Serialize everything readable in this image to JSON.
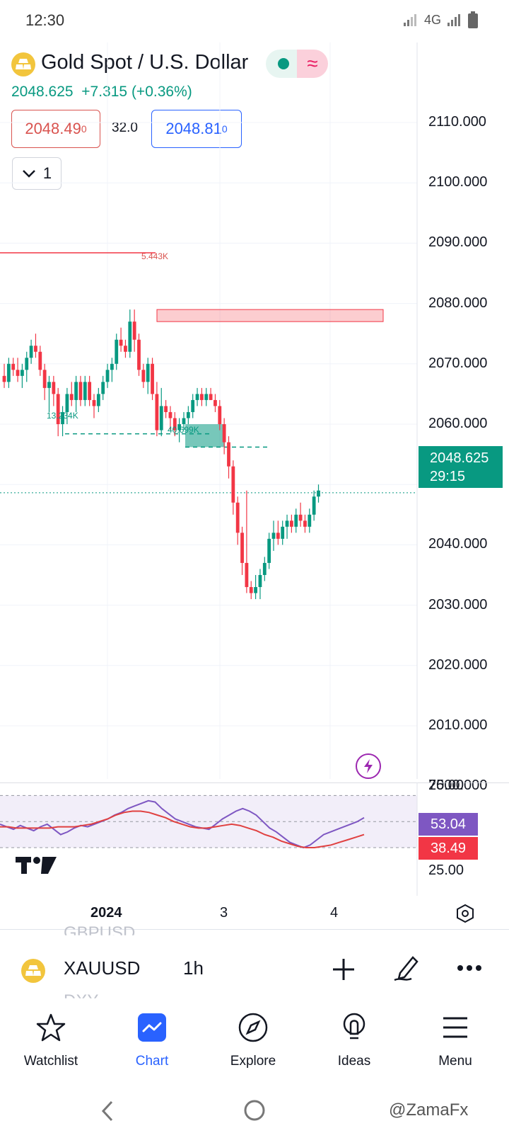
{
  "status_bar": {
    "time": "12:30",
    "network": "4G"
  },
  "symbol": {
    "name": "Gold Spot / U.S. Dollar",
    "last": "2048.625",
    "change": "+7.315",
    "change_pct": "(+0.36%)",
    "bid": "2048.49",
    "bid_sup": "0",
    "spread": "32.0",
    "ask": "2048.81",
    "ask_sup": "0",
    "indicator_count": "1"
  },
  "price_axis": [
    "2110.000",
    "2100.000",
    "2090.000",
    "2080.000",
    "2070.000",
    "2060.000",
    "2050.000",
    "2040.000",
    "2030.000",
    "2020.000",
    "2010.000",
    "2000.000"
  ],
  "current_price_tag": {
    "price": "2048.625",
    "countdown": "29:15"
  },
  "chart_annotations": {
    "high_volume": "5.443K",
    "low_left_volume": "13.234K",
    "low_mid_volume": "40.699K"
  },
  "rsi": {
    "axis_top": "75.00",
    "axis_bottom": "25.00",
    "rsi_value": "53.04",
    "ma_value": "38.49"
  },
  "time_axis": [
    "2024",
    "3",
    "4"
  ],
  "toolbar": {
    "ticker": "XAUUSD",
    "timeframe": "1h",
    "ghost_above": "GBPUSD",
    "ghost_below": "DXY"
  },
  "nav": [
    {
      "label": "Watchlist",
      "icon": "star-icon"
    },
    {
      "label": "Chart",
      "icon": "chart-icon"
    },
    {
      "label": "Explore",
      "icon": "compass-icon"
    },
    {
      "label": "Ideas",
      "icon": "lightbulb-icon"
    },
    {
      "label": "Menu",
      "icon": "menu-icon"
    }
  ],
  "watermark": "@ZamaFx",
  "colors": {
    "up": "#089981",
    "down": "#f23645",
    "accent": "#2962ff",
    "rsi": "#7e57c2",
    "rsi_ma": "#e04040"
  },
  "chart_data": {
    "type": "candlestick",
    "title": "",
    "xlabel": "",
    "ylabel": "",
    "ylim": [
      1996,
      2116
    ],
    "x": [
      0,
      1,
      2,
      3,
      4,
      5,
      6,
      7,
      8,
      9,
      10,
      11,
      12,
      13,
      14,
      15,
      16,
      17,
      18,
      19,
      20,
      21,
      22,
      23,
      24,
      25,
      26,
      27,
      28,
      29,
      30,
      31,
      32,
      33,
      34,
      35,
      36,
      37,
      38,
      39,
      40,
      41,
      42,
      43,
      44,
      45,
      46,
      47,
      48,
      49,
      50,
      51,
      52,
      53,
      54,
      55,
      56,
      57,
      58,
      59,
      60,
      61,
      62,
      63,
      64,
      65,
      66,
      67,
      68,
      69,
      70,
      71,
      72,
      73,
      74,
      75,
      76,
      77,
      78,
      79,
      80
    ],
    "ohlc": [
      [
        2068,
        2070,
        2066,
        2067
      ],
      [
        2067,
        2071,
        2066,
        2070
      ],
      [
        2070,
        2071,
        2068,
        2069
      ],
      [
        2069,
        2071,
        2067,
        2068
      ],
      [
        2068,
        2070,
        2066,
        2069
      ],
      [
        2069,
        2072,
        2067,
        2071
      ],
      [
        2071,
        2074,
        2070,
        2073
      ],
      [
        2073,
        2075,
        2071,
        2072
      ],
      [
        2072,
        2073,
        2068,
        2069
      ],
      [
        2069,
        2070,
        2064,
        2066
      ],
      [
        2066,
        2068,
        2062,
        2067
      ],
      [
        2067,
        2068,
        2063,
        2065
      ],
      [
        2065,
        2066,
        2058,
        2060
      ],
      [
        2060,
        2063,
        2058,
        2062
      ],
      [
        2062,
        2066,
        2060,
        2065
      ],
      [
        2065,
        2067,
        2063,
        2064
      ],
      [
        2064,
        2068,
        2062,
        2067
      ],
      [
        2067,
        2068,
        2063,
        2064
      ],
      [
        2064,
        2068,
        2063,
        2067
      ],
      [
        2067,
        2068,
        2063,
        2064
      ],
      [
        2064,
        2065,
        2061,
        2063
      ],
      [
        2063,
        2066,
        2062,
        2065
      ],
      [
        2065,
        2068,
        2064,
        2067
      ],
      [
        2067,
        2070,
        2066,
        2069
      ],
      [
        2069,
        2071,
        2067,
        2070
      ],
      [
        2070,
        2075,
        2069,
        2074
      ],
      [
        2074,
        2076,
        2072,
        2073
      ],
      [
        2073,
        2074,
        2071,
        2072
      ],
      [
        2072,
        2079,
        2071,
        2077
      ],
      [
        2077,
        2079,
        2072,
        2074
      ],
      [
        2074,
        2075,
        2068,
        2069
      ],
      [
        2069,
        2070,
        2066,
        2067
      ],
      [
        2067,
        2071,
        2065,
        2070
      ],
      [
        2070,
        2071,
        2064,
        2065
      ],
      [
        2065,
        2067,
        2058,
        2059
      ],
      [
        2059,
        2066,
        2058,
        2063
      ],
      [
        2063,
        2064,
        2061,
        2062
      ],
      [
        2062,
        2063,
        2059,
        2061
      ],
      [
        2061,
        2062,
        2058,
        2059
      ],
      [
        2059,
        2061,
        2057,
        2060
      ],
      [
        2060,
        2062,
        2059,
        2061
      ],
      [
        2061,
        2063,
        2060,
        2062
      ],
      [
        2062,
        2065,
        2061,
        2064
      ],
      [
        2064,
        2066,
        2063,
        2065
      ],
      [
        2065,
        2066,
        2063,
        2064
      ],
      [
        2064,
        2066,
        2063,
        2065
      ],
      [
        2065,
        2066,
        2064,
        2064
      ],
      [
        2064,
        2065,
        2062,
        2063
      ],
      [
        2063,
        2064,
        2059,
        2060
      ],
      [
        2060,
        2061,
        2055,
        2057
      ],
      [
        2057,
        2058,
        2051,
        2053
      ],
      [
        2053,
        2054,
        2045,
        2047
      ],
      [
        2047,
        2048,
        2040,
        2042
      ],
      [
        2042,
        2043,
        2035,
        2037
      ],
      [
        2037,
        2049,
        2032,
        2033
      ],
      [
        2033,
        2034,
        2031,
        2032
      ],
      [
        2032,
        2035,
        2031,
        2033
      ],
      [
        2033,
        2036,
        2031,
        2035
      ],
      [
        2035,
        2038,
        2034,
        2037
      ],
      [
        2037,
        2042,
        2036,
        2041
      ],
      [
        2041,
        2044,
        2039,
        2042
      ],
      [
        2042,
        2044,
        2040,
        2041
      ],
      [
        2041,
        2044,
        2040,
        2043
      ],
      [
        2043,
        2045,
        2041,
        2044
      ],
      [
        2044,
        2045,
        2042,
        2043
      ],
      [
        2043,
        2046,
        2042,
        2045
      ],
      [
        2045,
        2047,
        2043,
        2044
      ],
      [
        2044,
        2045,
        2042,
        2043
      ],
      [
        2043,
        2046,
        2042,
        2045
      ],
      [
        2045,
        2049,
        2044,
        2048
      ],
      [
        2048,
        2050,
        2047,
        2049
      ]
    ],
    "rsi": [
      48,
      46,
      44,
      47,
      45,
      43,
      46,
      48,
      44,
      40,
      42,
      45,
      47,
      46,
      48,
      50,
      52,
      55,
      57,
      60,
      62,
      64,
      66,
      65,
      60,
      56,
      52,
      50,
      48,
      46,
      45,
      44,
      48,
      52,
      55,
      58,
      60,
      58,
      55,
      50,
      45,
      42,
      38,
      34,
      32,
      30,
      32,
      36,
      40,
      42,
      44,
      46,
      48,
      50,
      53
    ],
    "rsi_ma": [
      46,
      46,
      45,
      45,
      45,
      45,
      45,
      46,
      46,
      46,
      47,
      48,
      50,
      52,
      55,
      57,
      58,
      58,
      57,
      55,
      53,
      50,
      48,
      46,
      45,
      45,
      46,
      47,
      48,
      47,
      45,
      43,
      40,
      38,
      35,
      33,
      31,
      30,
      30,
      31,
      32,
      34,
      36,
      38,
      40
    ],
    "rsi_range": [
      0,
      100
    ]
  }
}
